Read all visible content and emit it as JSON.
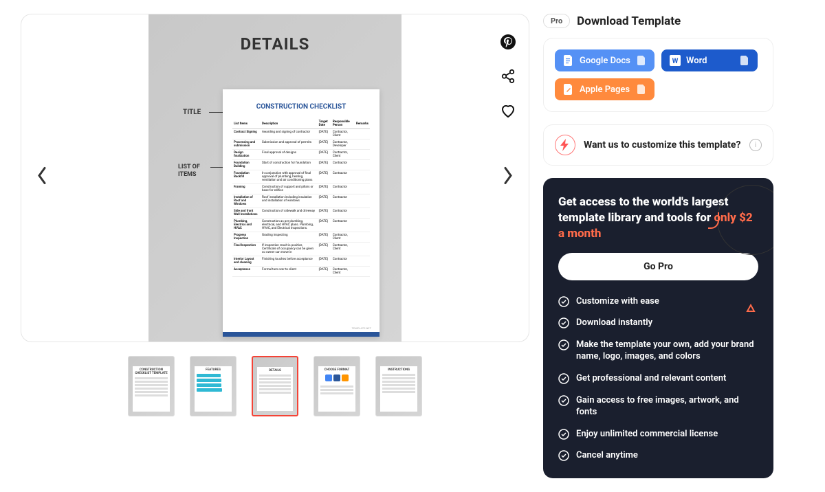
{
  "preview": {
    "header": "DETAILS",
    "labelTitle": "TITLE",
    "labelList": "LIST OF\nITEMS",
    "docTitle": "CONSTRUCTION CHECKLIST",
    "watermark": "TEMPLATE.NET",
    "columns": [
      "List Items",
      "Description",
      "Target Date",
      "Responsible Person",
      "Remarks"
    ],
    "rows": [
      [
        "Contract Signing",
        "Awarding and signing of contractor",
        "[DATE]",
        "Contractor, Client",
        ""
      ],
      [
        "Processing and submission",
        "Submission and approval of permits",
        "[DATE]",
        "Contractor, Developer",
        ""
      ],
      [
        "Design finalization",
        "Final approval of designs",
        "[DATE]",
        "Contractor, Client",
        ""
      ],
      [
        "Foundation Building",
        "Start of construction for foundation",
        "[DATE]",
        "Contractor",
        ""
      ],
      [
        "Foundation Backfill",
        "In conjunction with approval of final approval of plumbing, heating, ventilation and air conditioning plans",
        "[DATE]",
        "Contractor",
        ""
      ],
      [
        "Framing",
        "Construction of support and pillars or base for edifice",
        "[DATE]",
        "Contractor",
        ""
      ],
      [
        "Installation of Roof and Windows",
        "Roof installation including insulation and installation of windows",
        "[DATE]",
        "Contractor",
        ""
      ],
      [
        "Side and front Wall Installations",
        "Construction of sidewalk and driveway",
        "[DATE]",
        "Contractor",
        ""
      ],
      [
        "Plumbing, Electrics and HVAC",
        "Construction as per plumbing, electrical, and HVAC plans. Plumbing, HVAC, and Electrical Inspections.",
        "[DATE]",
        "Contractor",
        ""
      ],
      [
        "Progress Inspection",
        "Grading inspecting",
        "[DATE]",
        "Contractor, Client",
        ""
      ],
      [
        "Final Inspection",
        "If inspection result is positive, Certificate of occupancy can be given so owner can move in",
        "[DATE]",
        "Contractor, Client",
        ""
      ],
      [
        "Interior Layout and cleaning",
        "Finishing touches before acceptance",
        "[DATE]",
        "Contractor",
        ""
      ],
      [
        "Acceptance",
        "Formal turn over to client",
        "[DATE]",
        "Contractor, Client",
        ""
      ]
    ]
  },
  "thumbs": [
    {
      "label": "CONSTRUCTION CHECKLIST TEMPLATE"
    },
    {
      "label": "FEATURES"
    },
    {
      "label": "DETAILS"
    },
    {
      "label": "CHOOSE FORMAT"
    },
    {
      "label": "INSTRUCTIONS"
    }
  ],
  "download": {
    "pro": "Pro",
    "title": "Download Template",
    "gdocs": "Google Docs",
    "word": "Word",
    "pages": "Apple Pages"
  },
  "customize": {
    "text": "Want us to customize this template?"
  },
  "proCard": {
    "titlePrefix": "Get access to the world's largest template library and tools for ",
    "price": "only $2 a month",
    "cta": "Go Pro",
    "features": [
      "Customize with ease",
      "Download instantly",
      "Make the template your own, add your brand name, logo, images, and colors",
      "Get professional and relevant content",
      "Gain access to free images, artwork, and fonts",
      "Enjoy unlimited commercial license",
      "Cancel anytime"
    ]
  }
}
